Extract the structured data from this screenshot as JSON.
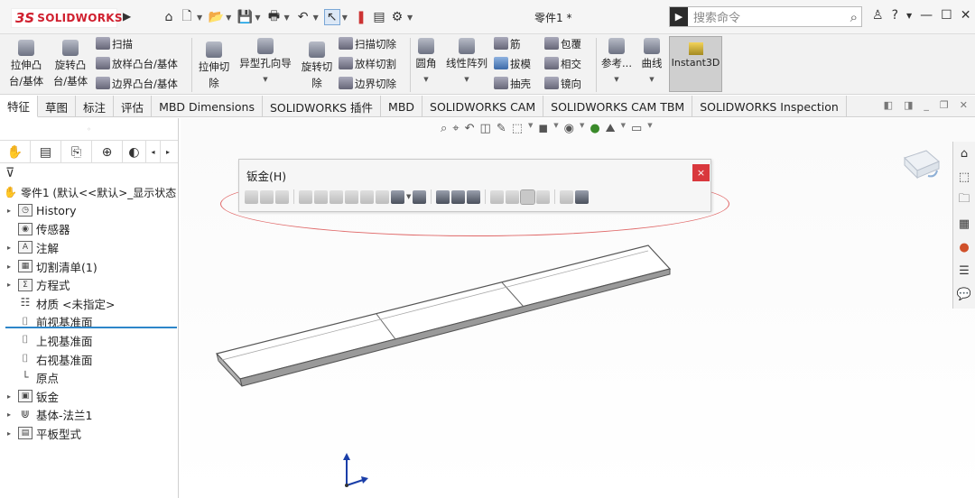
{
  "app": {
    "logo_ds": "3S",
    "logo_name": "SOLIDWORKS",
    "document_title": "零件1 *"
  },
  "search": {
    "placeholder": "搜索命令"
  },
  "ribbon": {
    "extrude_boss": [
      "拉伸凸",
      "台/基体"
    ],
    "revolve_boss": [
      "旋转凸",
      "台/基体"
    ],
    "sweep": "扫描",
    "loft_boss": "放样凸台/基体",
    "boundary_boss": "边界凸台/基体",
    "extrude_cut": [
      "拉伸切",
      "除"
    ],
    "hole_wizard": "异型孔向导",
    "revolve_cut": [
      "旋转切",
      "除"
    ],
    "sweep_cut": "扫描切除",
    "loft_cut": "放样切割",
    "boundary_cut": "边界切除",
    "fillet": "圆角",
    "linear_pattern": "线性阵列",
    "rib": "筋",
    "draft": "拔模",
    "shell": "抽壳",
    "wrap": "包覆",
    "intersect": "相交",
    "mirror": "镜向",
    "reference": "参考...",
    "curves": "曲线",
    "instant3d": "Instant3D"
  },
  "tabs": [
    "特征",
    "草图",
    "标注",
    "评估",
    "MBD Dimensions",
    "SOLIDWORKS 插件",
    "MBD",
    "SOLIDWORKS CAM",
    "SOLIDWORKS CAM TBM",
    "SOLIDWORKS Inspection"
  ],
  "tree": {
    "root": "零件1 (默认<<默认>_显示状态",
    "items": [
      {
        "label": "History",
        "expandable": true
      },
      {
        "label": "传感器",
        "expandable": false
      },
      {
        "label": "注解",
        "expandable": true
      },
      {
        "label": "切割清单(1)",
        "expandable": true
      },
      {
        "label": "方程式",
        "expandable": true
      },
      {
        "label": "材质 <未指定>",
        "expandable": false
      },
      {
        "label": "前视基准面",
        "expandable": false
      },
      {
        "label": "上视基准面",
        "expandable": false
      },
      {
        "label": "右视基准面",
        "expandable": false
      },
      {
        "label": "原点",
        "expandable": false
      },
      {
        "label": "钣金",
        "expandable": true
      },
      {
        "label": "基体-法兰1",
        "expandable": true
      },
      {
        "label": "平板型式",
        "expandable": true
      }
    ]
  },
  "sheet_metal_toolbar": {
    "title": "钣金(H)",
    "close": "×"
  },
  "colors": {
    "accent_red": "#d0202f",
    "close_red": "#d9383d",
    "highlight_ellipse": "#e06868",
    "tree_underline": "#2d86c9"
  }
}
